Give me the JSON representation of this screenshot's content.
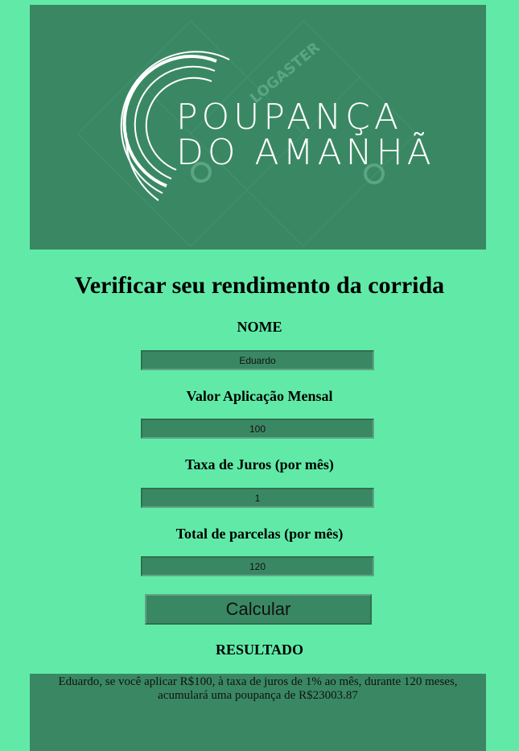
{
  "banner": {
    "logo_line1": "POUPANÇA",
    "logo_line2": "DO AMANHÃ",
    "watermark": "LOGASTER"
  },
  "page_title": "Verificar seu rendimento da corrida",
  "form": {
    "name_label": "NOME",
    "name_value": "Eduardo",
    "monthly_label": "Valor Aplicação Mensal",
    "monthly_value": "100",
    "rate_label": "Taxa de Juros (por mês)",
    "rate_value": "1",
    "installments_label": "Total de parcelas (por mês)",
    "installments_value": "120",
    "submit_label": "Calcular"
  },
  "result": {
    "heading": "RESULTADO",
    "text": "Eduardo, se você aplicar R$100, à taxa de juros de 1% ao mês, durante 120 meses, acumulará uma poupança de R$23003.87"
  },
  "colors": {
    "background": "#61eaa7",
    "panel": "#3a8863"
  }
}
